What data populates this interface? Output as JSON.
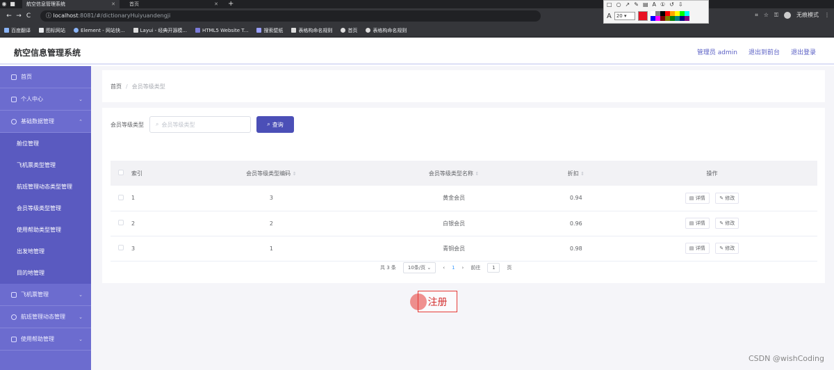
{
  "browser": {
    "tabs": [
      {
        "label": "航空信息管理系统",
        "active": true
      },
      {
        "label": "首页",
        "active": false
      }
    ],
    "url_host": "localhost",
    "url_path": ":8081/#/dictionaryHuiyuandengji",
    "profile_label": "无痕模式",
    "bookmarks": [
      "百度翻译",
      "图标网站",
      "Element - 网站快...",
      "Layui - 经典开源模...",
      "HTML5 Website T...",
      "搜索壁纸",
      "表格构命名规则",
      "首页",
      "表格构命名规则"
    ]
  },
  "annot_toolbar": {
    "font_size": "20",
    "colors": [
      "#e81123",
      "#ffffff",
      "#808080",
      "#000000",
      "#ff0000",
      "#ffa500",
      "#ffff00",
      "#00ff00",
      "#00ffff",
      "#0000ff",
      "#ff00ff",
      "#800000",
      "#808000",
      "#008000",
      "#008080",
      "#000080",
      "#800080"
    ]
  },
  "header": {
    "title": "航空信息管理系统",
    "links": [
      "管理员 admin",
      "退出到前台",
      "退出登录"
    ]
  },
  "sidebar": {
    "items": [
      {
        "label": "首页"
      },
      {
        "label": "个人中心"
      },
      {
        "label": "基础数据管理",
        "open": true,
        "children": [
          "舱位管理",
          "飞机票类型管理",
          "航班管理动态类型管理",
          "会员等级类型管理",
          "使用帮助类型管理",
          "出发地管理",
          "目的地管理"
        ]
      },
      {
        "label": "飞机票管理"
      },
      {
        "label": "航班管理动态管理"
      },
      {
        "label": "使用帮助管理"
      }
    ]
  },
  "breadcrumb": {
    "home": "首页",
    "sep": "/",
    "current": "会员等级类型"
  },
  "search": {
    "label": "会员等级类型",
    "placeholder": "会员等级类型",
    "button": "查询"
  },
  "table": {
    "headers": {
      "index": "索引",
      "code": "会员等级类型编码",
      "name": "会员等级类型名称",
      "discount": "折扣",
      "ops": "操作"
    },
    "rows": [
      {
        "index": "1",
        "code": "3",
        "name": "黄金会员",
        "discount": "0.94"
      },
      {
        "index": "2",
        "code": "2",
        "name": "白银会员",
        "discount": "0.96"
      },
      {
        "index": "3",
        "code": "1",
        "name": "青铜会员",
        "discount": "0.98"
      }
    ],
    "detail_label": "详情",
    "edit_label": "修改"
  },
  "pager": {
    "total": "共 3 条",
    "page_size": "10条/页",
    "current_page": "1",
    "goto_label": "前往",
    "goto_value": "1",
    "page_suffix": "页"
  },
  "overlay": {
    "register_text": "注册"
  },
  "watermark": "CSDN @wishCoding"
}
